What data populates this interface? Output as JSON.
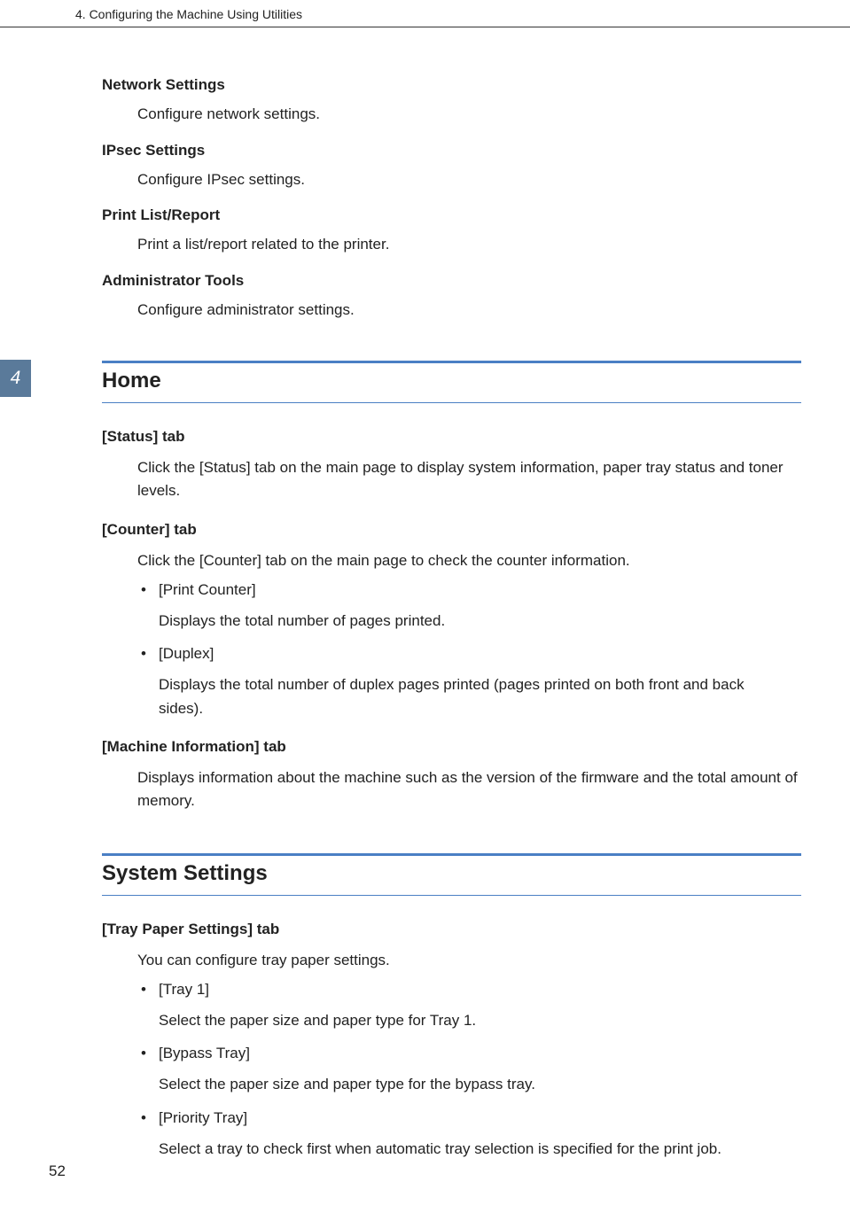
{
  "header": "4. Configuring the Machine Using Utilities",
  "tab_number": "4",
  "page_number": "52",
  "top_sections": [
    {
      "title": "Network Settings",
      "desc": "Configure network settings."
    },
    {
      "title": "IPsec Settings",
      "desc": "Configure IPsec settings."
    },
    {
      "title": "Print List/Report",
      "desc": "Print a list/report related to the printer."
    },
    {
      "title": "Administrator Tools",
      "desc": "Configure administrator settings."
    }
  ],
  "home": {
    "heading": "Home",
    "items": [
      {
        "title": "[Status] tab",
        "desc": "Click the [Status] tab on the main page to display system information, paper tray status and toner levels."
      },
      {
        "title": "[Counter] tab",
        "desc": "Click the [Counter] tab on the main page to check the counter information.",
        "bullets": [
          {
            "label": "[Print Counter]",
            "desc": "Displays the total number of pages printed."
          },
          {
            "label": "[Duplex]",
            "desc": "Displays the total number of duplex pages printed (pages printed on both front and back sides)."
          }
        ]
      },
      {
        "title": "[Machine Information] tab",
        "desc": "Displays information about the machine such as the version of the firmware and the total amount of memory."
      }
    ]
  },
  "system": {
    "heading": "System Settings",
    "items": [
      {
        "title": "[Tray Paper Settings] tab",
        "desc": "You can configure tray paper settings.",
        "bullets": [
          {
            "label": "[Tray 1]",
            "desc": "Select the paper size and paper type for Tray 1."
          },
          {
            "label": "[Bypass Tray]",
            "desc": "Select the paper size and paper type for the bypass tray."
          },
          {
            "label": "[Priority Tray]",
            "desc": "Select a tray to check first when automatic tray selection is specified for the print job."
          }
        ]
      }
    ]
  }
}
